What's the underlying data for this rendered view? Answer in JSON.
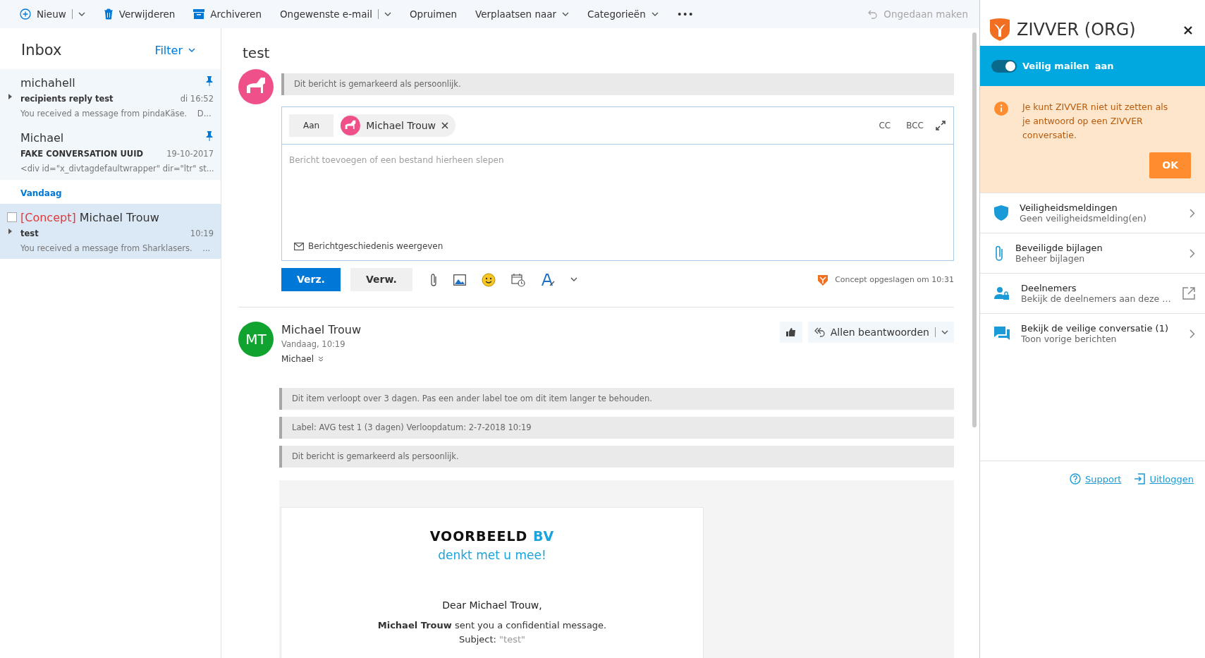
{
  "toolbar": {
    "items": [
      {
        "label": "Nieuw",
        "split": true,
        "menu": false
      },
      {
        "label": "Verwijderen",
        "split": false,
        "menu": false
      },
      {
        "label": "Archiveren",
        "split": false,
        "menu": false
      },
      {
        "label": "Ongewenste e-mail",
        "split": true,
        "menu": false
      },
      {
        "label": "Opruimen",
        "split": false,
        "menu": false
      },
      {
        "label": "Verplaatsen naar",
        "split": false,
        "menu": true
      },
      {
        "label": "Categorieën",
        "split": false,
        "menu": true
      },
      {
        "label": "•••",
        "split": false,
        "menu": false
      }
    ],
    "undo": {
      "label": "Ongedaan maken",
      "disabled": true
    }
  },
  "folder": {
    "title": "Inbox",
    "filter": "Filter"
  },
  "messages": [
    {
      "kind": "message",
      "sender": "michahell",
      "subject": "recipients reply test",
      "time": "di 16:52",
      "preview": "You received a message from pindaKäse.    D...",
      "pinned": true,
      "selected": false,
      "expandable": true
    },
    {
      "kind": "message",
      "sender": "Michael",
      "subject": "FAKE CONVERSATION UUID",
      "time": "19-10-2017",
      "preview": "<div id=\"x_divtagdefaultwrapper\" dir=\"ltr\" st...",
      "pinned": true,
      "selected": false,
      "expandable": false
    },
    {
      "kind": "group",
      "label": "Vandaag"
    },
    {
      "kind": "message",
      "draft": "[Concept]",
      "sender": "Michael Trouw",
      "subject": "test",
      "time": "10:19",
      "preview": "You received a message from Sharklasers.    ...",
      "pinned": false,
      "selected": true,
      "expandable": true,
      "checked": false
    }
  ],
  "reading": {
    "title": "test",
    "notice": "Dit bericht is gemarkeerd als persoonlijk.",
    "compose": {
      "to_label": "Aan",
      "recipient": "Michael Trouw",
      "cc": "CC",
      "bcc": "BCC",
      "placeholder": "Bericht toevoegen of een bestand hierheen slepen",
      "history": "Berichtgeschiedenis weergeven",
      "send": "Verz.",
      "discard": "Verw.",
      "saved": "Concept opgeslagen om 10:31"
    },
    "message": {
      "initials": "MT",
      "sender": "Michael Trouw",
      "date": "Vandaag, 10:19",
      "to": "Michael",
      "reply_all": "Allen beantwoorden",
      "notices": [
        "Dit item verloopt over 3 dagen. Pas een ander label toe om dit item langer te behouden.",
        "Label: AVG test 1 (3 dagen) Verloopdatum: 2-7-2018 10:19",
        "Dit bericht is gemarkeerd als persoonlijk."
      ],
      "body": {
        "brand": "VOORBEELD",
        "brand_accent": "BV",
        "tagline": "denkt met u mee!",
        "greeting": "Dear Michael Trouw,",
        "sentence": "**Michael Trouw** sent you a confidential message.",
        "subject_label": "Subject:",
        "subject_value": "\"test\""
      }
    }
  },
  "zivver": {
    "title": "ZIVVER (ORG)",
    "toggle": {
      "label": "Veilig mailen",
      "state": "aan",
      "on": true
    },
    "alert": {
      "text": "Je kunt ZIVVER niet uit zetten als je antwoord op een ZIVVER conversatie.",
      "button": "OK"
    },
    "items": [
      {
        "title": "Veiligheidsmeldingen",
        "subtitle": "Geen veiligheidsmelding(en)",
        "kind": "chevron"
      },
      {
        "title": "Beveiligde bijlagen",
        "subtitle": "Beheer bijlagen",
        "kind": "chevron"
      },
      {
        "title": "Deelnemers",
        "subtitle": "Bekijk de deelnemers aan deze …",
        "kind": "external"
      },
      {
        "title": "Bekijk de veilige conversatie (1)",
        "subtitle": "Toon vorige berichten",
        "kind": "chevron"
      }
    ],
    "footer": [
      "Support",
      "Uitloggen"
    ]
  }
}
